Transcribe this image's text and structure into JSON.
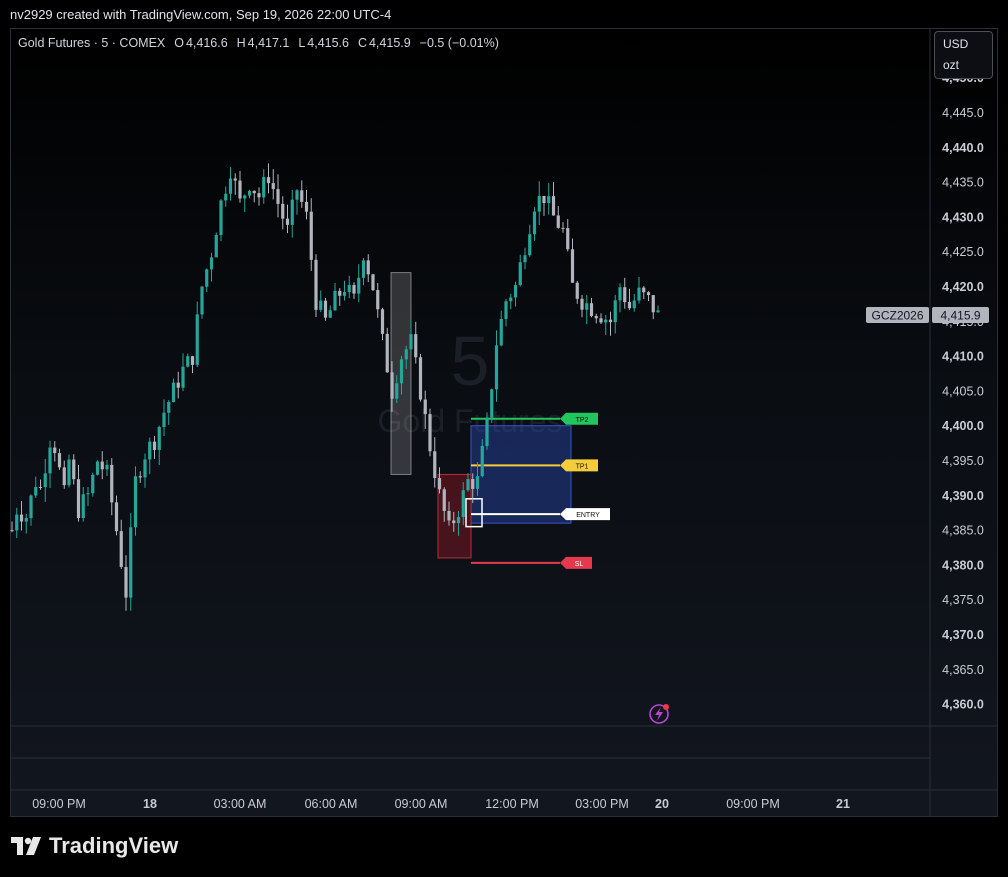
{
  "attribution": "nv2929 created with TradingView.com, Sep 19, 2026 22:00 UTC-4",
  "legend": {
    "symbol": "Gold Futures · 5 · COMEX",
    "o_label": "O",
    "o": "4,416.6",
    "h_label": "H",
    "h": "4,417.1",
    "l_label": "L",
    "l": "4,415.6",
    "c_label": "C",
    "c": "4,415.9",
    "change": "−0.5 (−0.01%)"
  },
  "currency": {
    "unit": "USD",
    "sub": "ozt"
  },
  "watermark": {
    "interval": "5",
    "name": "Gold Futures"
  },
  "footer": {
    "brand": "TradingView"
  },
  "colors": {
    "up": "#26a69a",
    "down": "#b2b5be",
    "tp2": "#22c55e",
    "tp1": "#f5cd3a",
    "sl": "#e5394c",
    "entry": "#ffffff",
    "box": "#1a2e6b"
  },
  "chart_data": {
    "type": "candlestick",
    "ylim": [
      4357,
      4457
    ],
    "y_ticks": [
      "4,450.0",
      "4,445.0",
      "4,440.0",
      "4,435.0",
      "4,430.0",
      "4,425.0",
      "4,420.0",
      "4,415.0",
      "4,410.0",
      "4,405.0",
      "4,400.0",
      "4,395.0",
      "4,390.0",
      "4,385.0",
      "4,380.0",
      "4,375.0",
      "4,370.0",
      "4,365.0",
      "4,360.0"
    ],
    "x_ticks": [
      "09:00 PM",
      "18",
      "03:00 AM",
      "06:00 AM",
      "09:00 AM",
      "12:00 PM",
      "03:00 PM",
      "20",
      "09:00 PM",
      "21"
    ],
    "price_label": {
      "symbol": "GCZ2026",
      "value": "4,415.9"
    },
    "path": [
      [
        0,
        4385
      ],
      [
        1,
        4388
      ],
      [
        3,
        4387
      ],
      [
        5,
        4392
      ],
      [
        6,
        4391
      ],
      [
        8,
        4398
      ],
      [
        9,
        4397
      ],
      [
        11,
        4390
      ],
      [
        12,
        4395
      ],
      [
        14,
        4388
      ],
      [
        16,
        4390
      ],
      [
        18,
        4395
      ],
      [
        20,
        4393
      ],
      [
        22,
        4385
      ],
      [
        24,
        4376
      ],
      [
        26,
        4392
      ],
      [
        28,
        4396
      ],
      [
        30,
        4398
      ],
      [
        32,
        4402
      ],
      [
        34,
        4405
      ],
      [
        36,
        4408
      ],
      [
        38,
        4410
      ],
      [
        40,
        4420
      ],
      [
        42,
        4425
      ],
      [
        44,
        4432
      ],
      [
        46,
        4437
      ],
      [
        48,
        4432
      ],
      [
        50,
        4435
      ],
      [
        52,
        4433
      ],
      [
        54,
        4436
      ],
      [
        56,
        4432
      ],
      [
        58,
        4428
      ],
      [
        60,
        4434
      ],
      [
        62,
        4430
      ],
      [
        64,
        4418
      ],
      [
        66,
        4415
      ],
      [
        68,
        4418
      ],
      [
        70,
        4420
      ],
      [
        72,
        4418
      ],
      [
        74,
        4425
      ],
      [
        76,
        4420
      ],
      [
        78,
        4412
      ],
      [
        80,
        4405
      ],
      [
        82,
        4410
      ],
      [
        84,
        4412
      ],
      [
        86,
        4405
      ],
      [
        88,
        4397
      ],
      [
        90,
        4390
      ],
      [
        92,
        4385
      ],
      [
        94,
        4388
      ],
      [
        96,
        4392
      ],
      [
        98,
        4392
      ],
      [
        100,
        4400
      ],
      [
        102,
        4412
      ],
      [
        104,
        4418
      ],
      [
        106,
        4420
      ],
      [
        108,
        4426
      ],
      [
        110,
        4432
      ],
      [
        112,
        4433
      ],
      [
        114,
        4430
      ],
      [
        116,
        4428
      ],
      [
        118,
        4420
      ],
      [
        120,
        4418
      ],
      [
        122,
        4417
      ],
      [
        124,
        4416
      ],
      [
        126,
        4415
      ],
      [
        128,
        4420
      ],
      [
        130,
        4417
      ],
      [
        132,
        4419
      ],
      [
        134,
        4418
      ],
      [
        136,
        4415.9
      ]
    ],
    "overlays": {
      "gray_box": {
        "from": 4422,
        "to": 4393
      },
      "blue_box": {
        "from": 4400,
        "to": 4386
      },
      "red_box": {
        "from": 4393,
        "to": 4381
      },
      "levels": [
        {
          "label": "TP2",
          "price": 4401
        },
        {
          "label": "TP1",
          "price": 4394.3
        },
        {
          "label": "ENTRY",
          "price": 4387.3
        },
        {
          "label": "SL",
          "price": 4380.3
        }
      ]
    }
  }
}
